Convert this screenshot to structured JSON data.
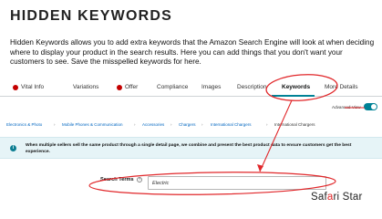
{
  "title": "HIDDEN KEYWORDS",
  "intro": "Hidden Keywords allows you to add extra keywords that the Amazon Search Engine will look at when deciding where to display your product in the search results. Here you can add things that you don't want your customers to see. Save the misspelled keywords for here.",
  "tabs": {
    "vital_info": "Vital Info",
    "variations": "Variations",
    "offer": "Offer",
    "compliance": "Compliance",
    "images": "Images",
    "description": "Description",
    "keywords": "Keywords",
    "more_details": "More Details"
  },
  "advanced_view": {
    "label": "Advanced View",
    "enabled": true
  },
  "breadcrumb": {
    "c1": "Electronics & Photo",
    "c2": "Mobile Phones & Communication",
    "c3": "Accessories",
    "c4": "Chargers",
    "c5": "International Chargers",
    "c6": "International Chargers"
  },
  "notice": {
    "icon": "i",
    "text": "When multiple sellers sell the same product through a single detail page, we combine and present the best product data to ensure customers get the best experience."
  },
  "search_terms": {
    "label": "Search Terms",
    "help": "?",
    "value": "Electric"
  },
  "logo": {
    "part1": "Saf",
    "accent": "a",
    "part2": "ri Star"
  },
  "colors": {
    "accent_teal": "#008296",
    "annotation_red": "#e1272a",
    "warning_red": "#c40000",
    "notice_bg": "#e6f4f7",
    "link_blue": "#0066c0"
  }
}
